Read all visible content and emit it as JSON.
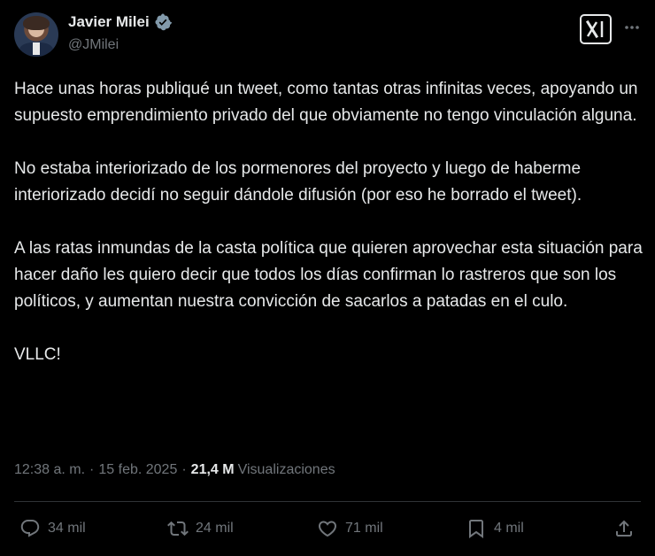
{
  "author": {
    "name": "Javier Milei",
    "handle": "@JMilei"
  },
  "tweet": {
    "paragraphs": [
      "Hace unas horas publiqué un tweet, como tantas otras infinitas veces, apoyando un supuesto emprendimiento privado del que obviamente no tengo vinculación alguna.",
      "No estaba interiorizado de los pormenores del proyecto y luego de haberme interiorizado decidí no seguir dándole difusión (por eso he borrado el tweet).",
      "A las ratas inmundas de la casta política que quieren aprovechar esta situación para hacer daño les quiero decir que todos los días confirman lo rastreros que son los políticos, y aumentan nuestra convicción de sacarlos a patadas en el culo.",
      "VLLC!"
    ]
  },
  "meta": {
    "time": "12:38 a. m.",
    "separator": "·",
    "date": "15 feb. 2025",
    "views_count": "21,4 M",
    "views_label": "Visualizaciones"
  },
  "actions": {
    "replies": "34 mil",
    "reposts": "24 mil",
    "likes": "71 mil",
    "bookmarks": "4 mil"
  },
  "icons": [
    "verified-badge-icon",
    "grok-logo-icon",
    "more-icon",
    "reply-icon",
    "repost-icon",
    "like-icon",
    "bookmark-icon",
    "share-icon"
  ],
  "colors": {
    "background": "#000000",
    "text": "#e7e9ea",
    "secondary": "#71767b",
    "verified": "#829aab",
    "divider": "#2f3336"
  }
}
